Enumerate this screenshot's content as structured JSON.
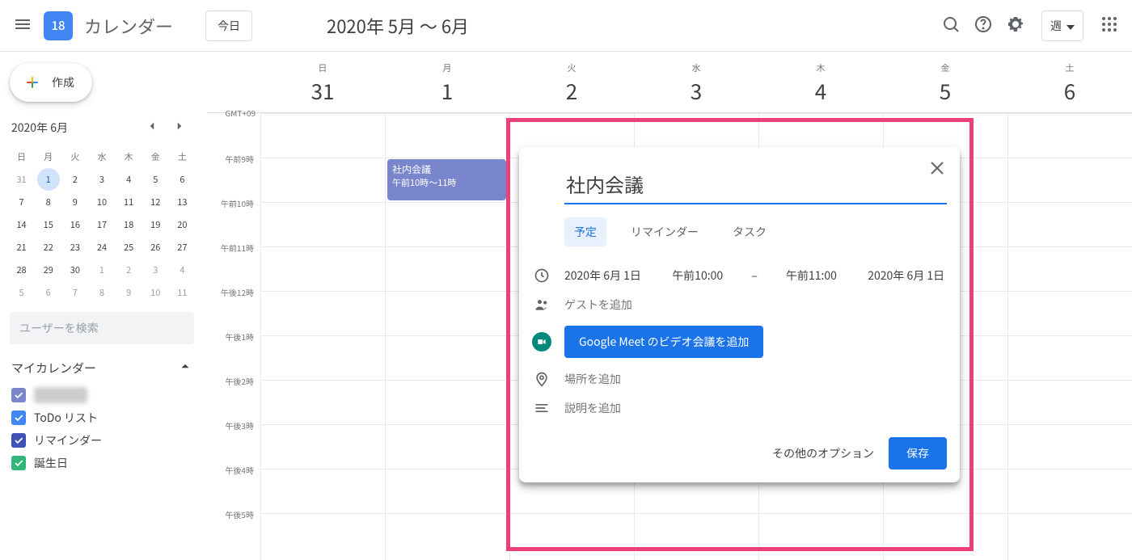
{
  "header": {
    "logo_day": "18",
    "app_title": "カレンダー",
    "today": "今日",
    "date_range": "2020年 5月 ～ 6月",
    "view": "週"
  },
  "sidebar": {
    "create": "作成",
    "mini_month": "2020年 6月",
    "dow": [
      "日",
      "月",
      "火",
      "水",
      "木",
      "金",
      "土"
    ],
    "days": [
      {
        "n": "31",
        "dim": true
      },
      {
        "n": "1",
        "sel": true
      },
      {
        "n": "2"
      },
      {
        "n": "3"
      },
      {
        "n": "4"
      },
      {
        "n": "5"
      },
      {
        "n": "6"
      },
      {
        "n": "7"
      },
      {
        "n": "8"
      },
      {
        "n": "9"
      },
      {
        "n": "10"
      },
      {
        "n": "11"
      },
      {
        "n": "12"
      },
      {
        "n": "13"
      },
      {
        "n": "14"
      },
      {
        "n": "15"
      },
      {
        "n": "16"
      },
      {
        "n": "17"
      },
      {
        "n": "18"
      },
      {
        "n": "19"
      },
      {
        "n": "20"
      },
      {
        "n": "21"
      },
      {
        "n": "22"
      },
      {
        "n": "23"
      },
      {
        "n": "24"
      },
      {
        "n": "25"
      },
      {
        "n": "26"
      },
      {
        "n": "27"
      },
      {
        "n": "28"
      },
      {
        "n": "29"
      },
      {
        "n": "30"
      },
      {
        "n": "1",
        "dim": true
      },
      {
        "n": "2",
        "dim": true
      },
      {
        "n": "3",
        "dim": true
      },
      {
        "n": "4",
        "dim": true
      },
      {
        "n": "5",
        "dim": true
      },
      {
        "n": "6",
        "dim": true
      },
      {
        "n": "7",
        "dim": true
      },
      {
        "n": "8",
        "dim": true
      },
      {
        "n": "9",
        "dim": true
      },
      {
        "n": "10",
        "dim": true
      },
      {
        "n": "11",
        "dim": true
      }
    ],
    "search_placeholder": "ユーザーを検索",
    "mycal_label": "マイカレンダー",
    "cals": [
      {
        "label": "██████",
        "color": "#7986cb"
      },
      {
        "label": "ToDo リスト",
        "color": "#4285f4"
      },
      {
        "label": "リマインダー",
        "color": "#3f51b5"
      },
      {
        "label": "誕生日",
        "color": "#33b679"
      }
    ]
  },
  "grid": {
    "tz": "GMT+09",
    "dow": [
      "日",
      "月",
      "火",
      "水",
      "木",
      "金",
      "土"
    ],
    "dates": [
      "31",
      "1",
      "2",
      "3",
      "4",
      "5",
      "6"
    ],
    "hours": [
      "午前9時",
      "午前10時",
      "午前11時",
      "午後12時",
      "午後1時",
      "午後2時",
      "午後3時",
      "午後4時",
      "午後5時"
    ],
    "event": {
      "title": "社内会議",
      "time": "午前10時～11時",
      "day_index": 1,
      "hour_index": 1
    }
  },
  "popup": {
    "title": "社内会議",
    "tabs": [
      "予定",
      "リマインダー",
      "タスク"
    ],
    "date_start": "2020年 6月 1日",
    "time_start": "午前10:00",
    "sep": "–",
    "time_end": "午前11:00",
    "date_end": "2020年 6月 1日",
    "guests": "ゲストを追加",
    "meet": "Google Meet のビデオ会議を追加",
    "location": "場所を追加",
    "description": "説明を追加",
    "more": "その他のオプション",
    "save": "保存"
  }
}
